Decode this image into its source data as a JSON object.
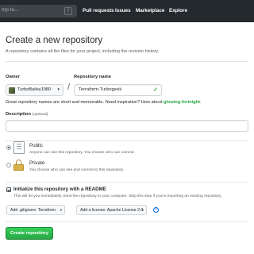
{
  "header": {
    "search_text": "mp to...",
    "slash_key": "/",
    "nav": [
      "Pull requests",
      "Issues",
      "Marketplace",
      "Explore"
    ]
  },
  "page": {
    "title": "Create a new repository",
    "subtitle": "A repository contains all the files for your project, including the revision history."
  },
  "form": {
    "owner_label": "Owner",
    "owner_value": "TurboBailey1980",
    "repo_label": "Repository name",
    "repo_value": "Terraform-Turbogeek",
    "hint_prefix": "Great repository names are short and memorable. Need inspiration? How about ",
    "hint_suggestion": "glowing-fortnight",
    "hint_suffix": ".",
    "desc_label": "Description",
    "desc_optional": "(optional)",
    "desc_value": ""
  },
  "visibility": {
    "public_title": "Public",
    "public_desc": "Anyone can see this repository. You choose who can commit.",
    "private_title": "Private",
    "private_desc": "You choose who can see and commit to this repository.",
    "selected": "Public"
  },
  "init": {
    "title": "Initialize this repository with a README",
    "desc": "This will let you immediately clone the repository to your computer. Skip this step if you're importing an existing repository.",
    "checked": true,
    "gitignore_label": "Add .gitignore: Terraform",
    "license_label": "Add a license: Apache License 2.0",
    "info_glyph": "i"
  },
  "actions": {
    "create_label": "Create repository"
  },
  "colors": {
    "header_bg": "#24292e",
    "accent_green": "#28a745",
    "link_blue": "#0366d6"
  }
}
